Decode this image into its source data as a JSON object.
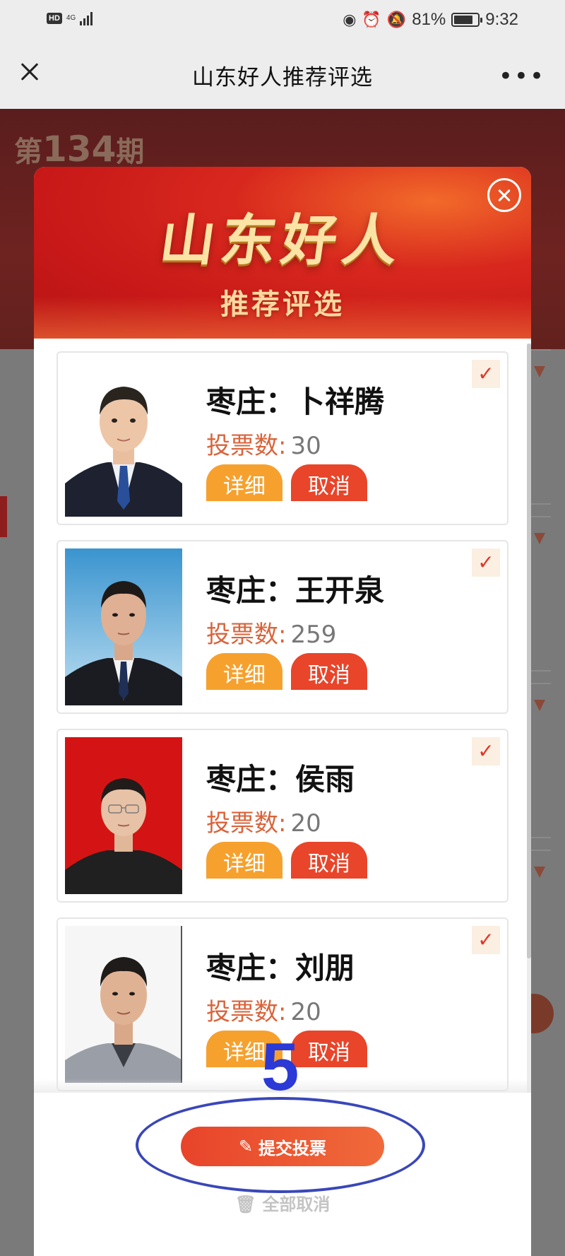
{
  "status_bar": {
    "hd": "HD",
    "network": "4G",
    "battery": "81%",
    "battery_level": 0.81,
    "time": "9:32",
    "icons": [
      "eye-icon",
      "alarm-icon",
      "bell-off-icon",
      "battery-icon",
      "signal-icon"
    ]
  },
  "title_bar": {
    "title": "山东好人推荐评选",
    "close_icon": "close-icon",
    "more_icon": "more-icon"
  },
  "background": {
    "issue_prefix": "第",
    "issue_number": "134",
    "issue_suffix": "期"
  },
  "modal": {
    "title": "山东好人",
    "subtitle": "推荐评选",
    "close_icon": "close-circle-icon",
    "votes_label": "投票数:",
    "detail_label": "详细",
    "cancel_label": "取消",
    "candidates": [
      {
        "name": "枣庄：卜祥腾",
        "votes": "30",
        "bg": "#ffffff"
      },
      {
        "name": "枣庄：王开泉",
        "votes": "259",
        "bg": "#4aa6d6"
      },
      {
        "name": "枣庄：侯雨",
        "votes": "20",
        "bg": "#d81818"
      },
      {
        "name": "枣庄：刘朋",
        "votes": "20",
        "bg": "#ffffff"
      }
    ],
    "submit_label": "提交投票",
    "cancel_all_label": "全部取消"
  },
  "annotation": {
    "number": "5",
    "color": "#2b39d6"
  },
  "colors": {
    "accent_red": "#e8452a",
    "accent_orange": "#f6a12e",
    "votes_label": "#d9643b"
  }
}
